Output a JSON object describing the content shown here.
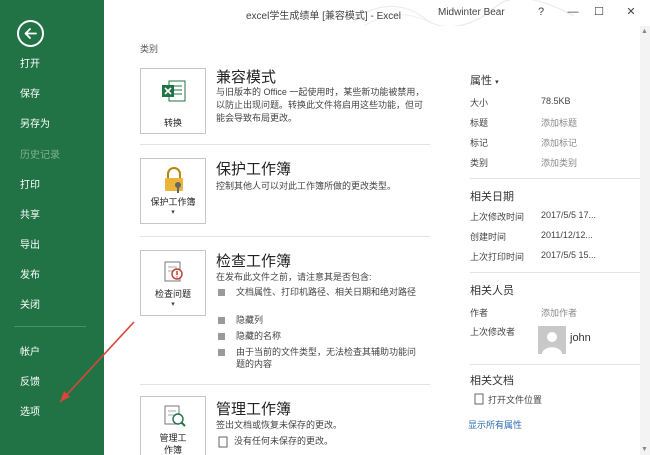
{
  "titlebar": {
    "title": "excel学生成绩单  [兼容模式]  -  Excel",
    "user": "Midwinter Bear",
    "help": "?",
    "minimize": "—",
    "restore": "☐",
    "close": "✕"
  },
  "sidebar": {
    "items": [
      {
        "label": "打开"
      },
      {
        "label": "保存"
      },
      {
        "label": "另存为"
      },
      {
        "label": "历史记录"
      },
      {
        "label": "打印"
      },
      {
        "label": "共享"
      },
      {
        "label": "导出"
      },
      {
        "label": "发布"
      },
      {
        "label": "关闭"
      },
      {
        "label": "帐户"
      },
      {
        "label": "反馈"
      },
      {
        "label": "选项"
      }
    ]
  },
  "main": {
    "top_partial": "类别",
    "compat": {
      "tile_label": "转换",
      "title": "兼容模式",
      "desc": "与旧版本的 Office 一起使用时，某些新功能被禁用，以防止出现问题。转换此文件将启用这些功能，但可能会导致布局更改。"
    },
    "protect": {
      "tile_label": "保护工作簿",
      "tile_caret": "▾",
      "title": "保护工作簿",
      "desc": "控制其他人可以对此工作簿所做的更改类型。"
    },
    "inspect": {
      "tile_label": "检查问题",
      "tile_caret": "▾",
      "title": "检查工作簿",
      "desc": "在发布此文件之前，请注意其是否包含:",
      "bullets": [
        "文档属性、打印机路径、相关日期和绝对路径",
        "隐藏列",
        "隐藏的名称",
        "由于当前的文件类型，无法检查其辅助功能问题的内容"
      ]
    },
    "manage": {
      "tile_label_1": "管理工",
      "tile_label_2": "作簿",
      "tile_caret": "▾",
      "title": "管理工作簿",
      "desc": "签出文档或恢复未保存的更改。",
      "note": "没有任何未保存的更改。"
    }
  },
  "properties": {
    "header": "属性",
    "header_caret": "▾",
    "rows": [
      {
        "label": "大小",
        "value": "78.5KB",
        "placeholder": false
      },
      {
        "label": "标题",
        "value": "添加标题",
        "placeholder": true
      },
      {
        "label": "标记",
        "value": "添加标记",
        "placeholder": true
      },
      {
        "label": "类别",
        "value": "添加类别",
        "placeholder": true
      }
    ],
    "dates_header": "相关日期",
    "dates": [
      {
        "label": "上次修改时间",
        "value": "2017/5/5 17..."
      },
      {
        "label": "创建时间",
        "value": "2011/12/12..."
      },
      {
        "label": "上次打印时间",
        "value": "2017/5/5 15..."
      }
    ],
    "people_header": "相关人员",
    "people": {
      "author_label": "作者",
      "author_value": "添加作者",
      "modified_label": "上次修改者",
      "modified_name": "john"
    },
    "docs_header": "相关文档",
    "open_location": "打开文件位置",
    "show_all": "显示所有属性"
  },
  "colors": {
    "sidebar": "#217346",
    "annotation": "#d9463a"
  }
}
